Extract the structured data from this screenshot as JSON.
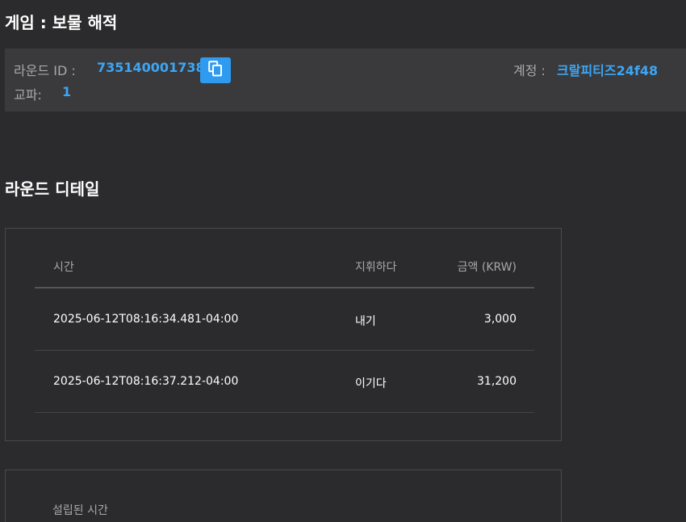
{
  "header": {
    "game_title": "게임 : 보물 해적"
  },
  "round_info": {
    "round_id_label": "라운드 ID :",
    "round_id_value": "735140001738",
    "account_label": "계정 :",
    "account_value": "크랄피티즈24f48",
    "shift_label": "교파:",
    "shift_value": "1",
    "copy_icon": "copy-icon",
    "copy_button_color": "#2f9bf0"
  },
  "details": {
    "section_title": "라운드 디테일",
    "columns": {
      "time": "시간",
      "action": "지휘하다",
      "amount": "금액 (KRW)"
    },
    "rows": [
      {
        "time": "2025-06-12T08:16:34.481-04:00",
        "action": "내기",
        "amount": "3,000"
      },
      {
        "time": "2025-06-12T08:16:37.212-04:00",
        "action": "이기다",
        "amount": "31,200"
      }
    ]
  },
  "settled": {
    "label": "설립된 시간"
  },
  "colors": {
    "background": "#2b2a2c",
    "panel": "#3a3a3c",
    "accent": "#3da5f4"
  }
}
